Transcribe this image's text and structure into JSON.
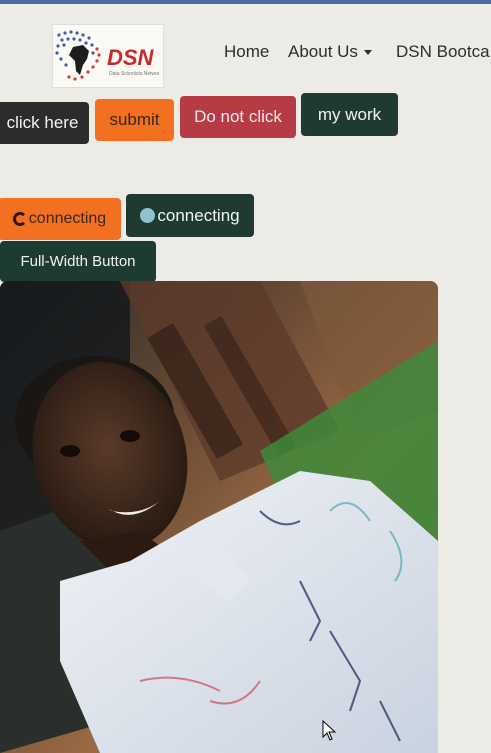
{
  "navbar": {
    "logo_text": "DSN",
    "logo_tagline": "Data Scientists Network",
    "links": [
      {
        "label": "Home"
      },
      {
        "label": "About Us"
      },
      {
        "label": "DSN Bootca"
      }
    ]
  },
  "buttons_row1": [
    {
      "label": "click here"
    },
    {
      "label": "submit"
    },
    {
      "label": "Do not click"
    },
    {
      "label": "my work"
    }
  ],
  "spinner_buttons": [
    {
      "label": "connecting",
      "spinner": "border-spinner-icon"
    },
    {
      "label": "connecting",
      "spinner": "grow-spinner-icon"
    }
  ],
  "full_width_button": {
    "label": "Full-Width Button"
  },
  "colors": {
    "dark": "#2c2c2c",
    "orange": "#f2701f",
    "red": "#b53c45",
    "green": "#1f3a31",
    "navbar": "#ecebe7"
  }
}
